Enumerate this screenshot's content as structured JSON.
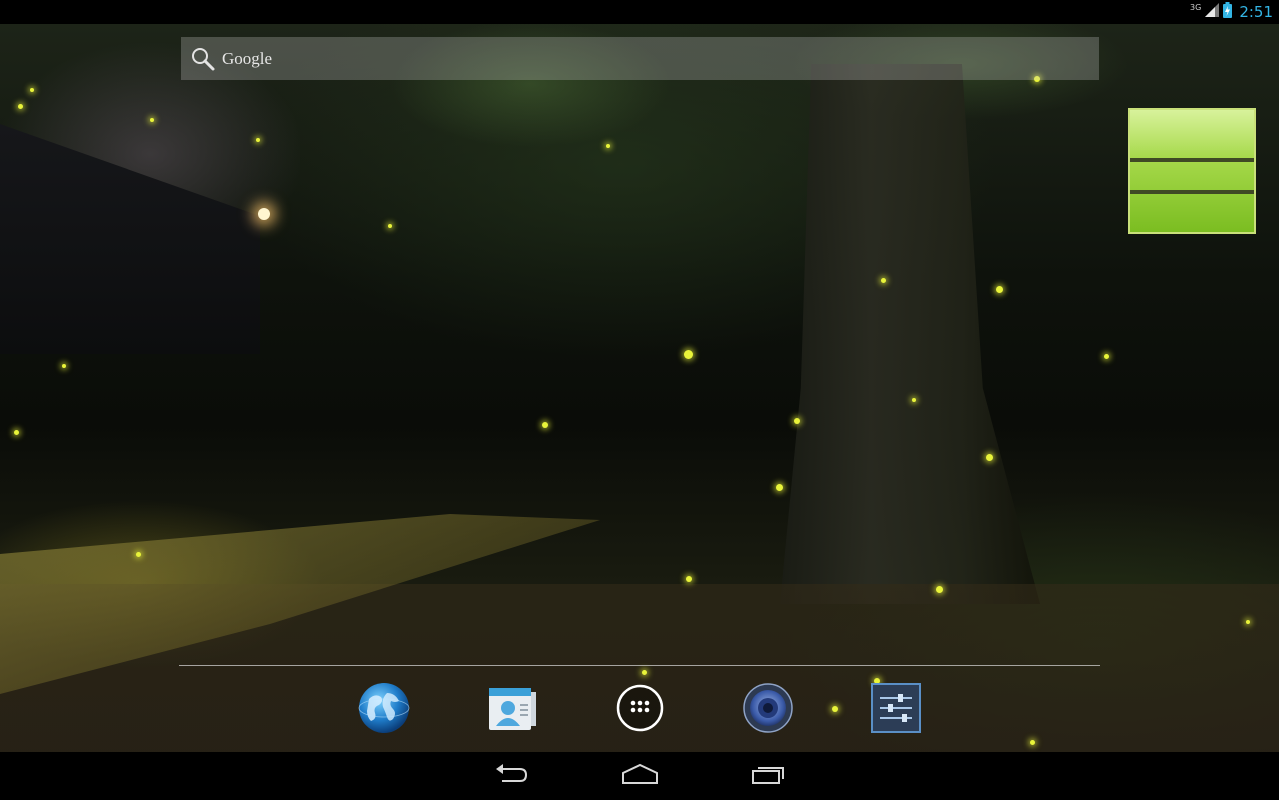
{
  "status_bar": {
    "network_label": "3G",
    "time": "2:51",
    "clock_color": "#33b5e5",
    "icons": [
      "signal-icon",
      "battery-icon"
    ]
  },
  "search": {
    "label": "Google",
    "icon": "search-icon"
  },
  "dock": {
    "apps": [
      {
        "name": "browser-app-icon",
        "icon": "globe-icon"
      },
      {
        "name": "contacts-app-icon",
        "icon": "contacts-icon"
      },
      {
        "name": "all-apps-button",
        "icon": "app-drawer-icon"
      },
      {
        "name": "music-app-icon",
        "icon": "speaker-icon"
      },
      {
        "name": "settings-app-icon",
        "icon": "sliders-icon"
      }
    ]
  },
  "nav_bar": {
    "buttons": [
      "back-icon",
      "home-icon",
      "recent-apps-icon"
    ]
  },
  "wallpaper": {
    "subject": "fireflies-night-garden",
    "accent_color": "#e9f43a"
  }
}
